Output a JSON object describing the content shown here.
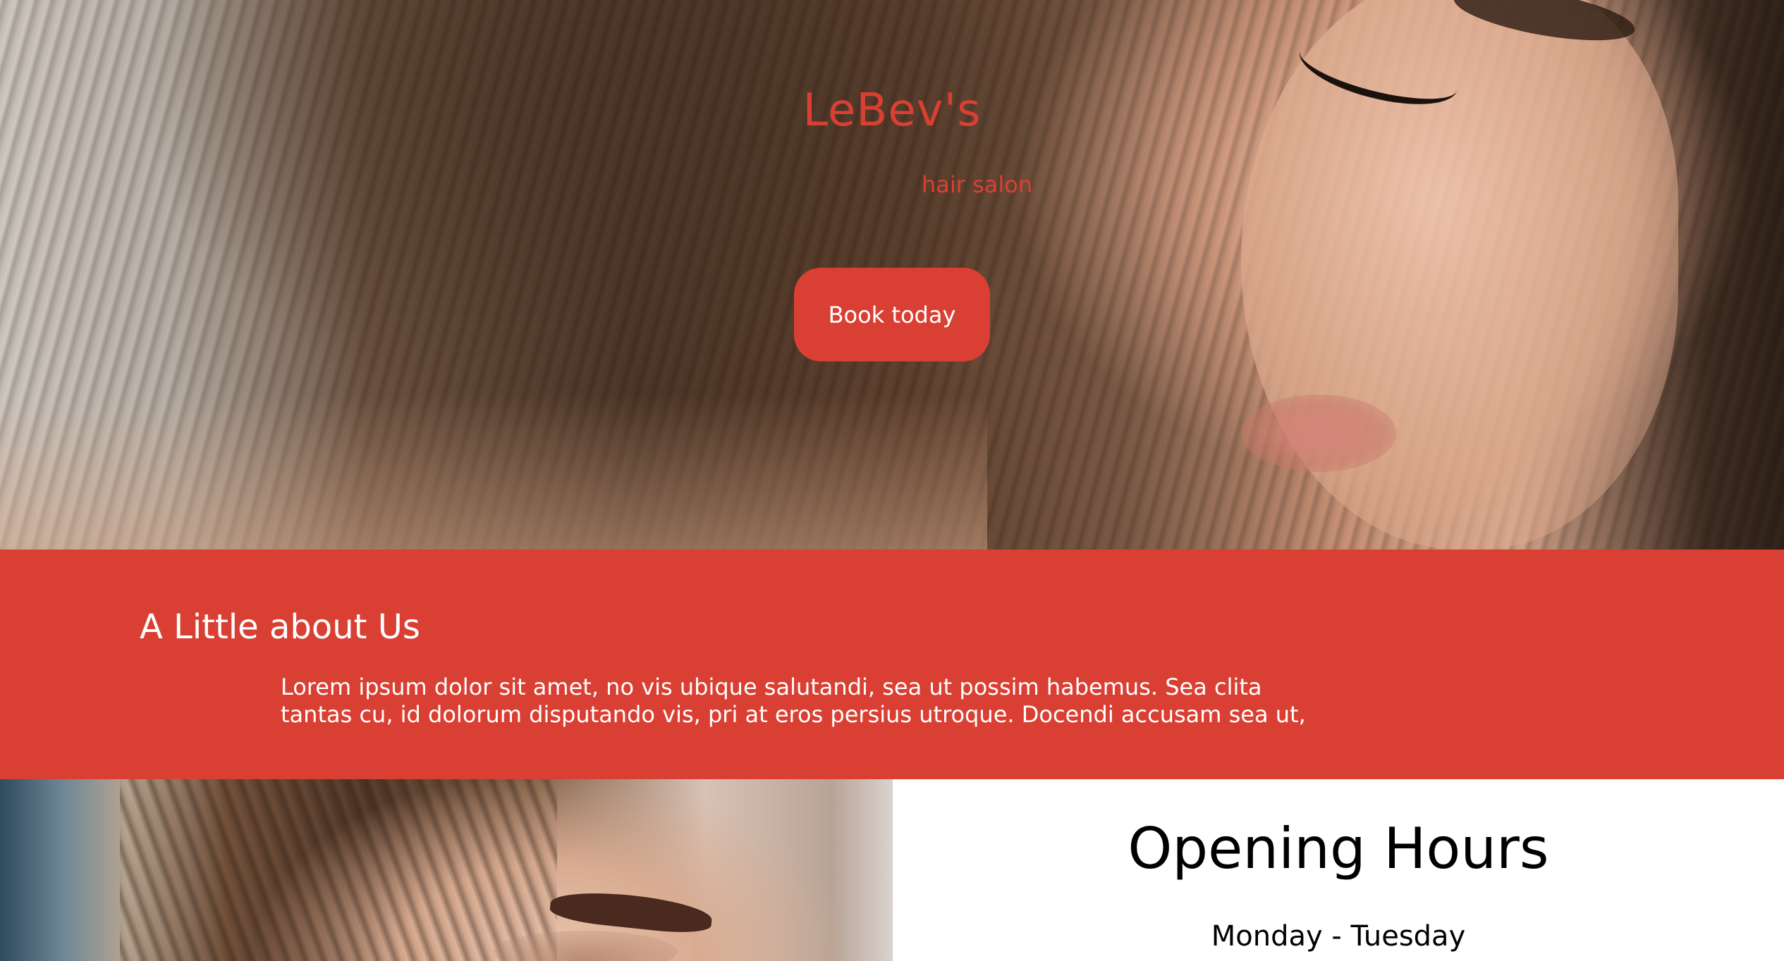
{
  "hero": {
    "brand_name": "LeBev's",
    "tagline": "hair salon",
    "cta_label": "Book today"
  },
  "about": {
    "heading": "A Little about Us",
    "body": "Lorem ipsum dolor sit amet, no vis ubique salutandi, sea ut possim habemus. Sea clita tantas cu, id dolorum disputando vis, pri at eros persius utroque. Docendi accusam sea ut,"
  },
  "hours": {
    "heading": "Opening Hours",
    "first_day_range": "Monday - Tuesday"
  },
  "colors": {
    "accent": "#d94033",
    "text_on_accent": "#ffffff",
    "text_dark": "#000000"
  }
}
